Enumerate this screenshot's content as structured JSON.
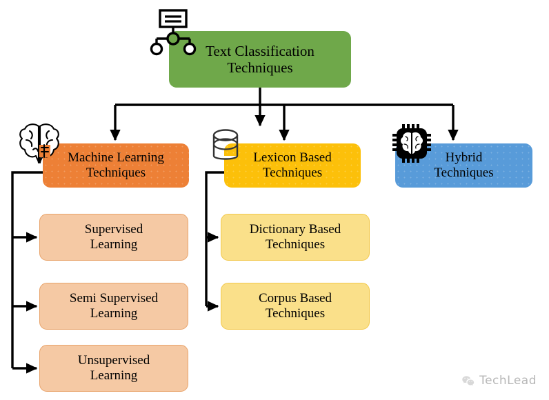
{
  "diagram": {
    "title": "Text Classification Techniques",
    "root": {
      "label": "Text Classification\nTechniques",
      "color": "#6FA84A",
      "icon": "hierarchy-icon"
    },
    "branches": [
      {
        "id": "machine-learning",
        "label": "Machine Learning\nTechniques",
        "color": "#ED8036",
        "icon": "brain-icon",
        "children": [
          {
            "id": "supervised-learning",
            "label": "Supervised\nLearning",
            "color": "#F5C9A4",
            "border": "#E8A36A"
          },
          {
            "id": "semi-supervised-learning",
            "label": "Semi Supervised\nLearning",
            "color": "#F5C9A4",
            "border": "#E8A36A"
          },
          {
            "id": "unsupervised-learning",
            "label": "Unsupervised\nLearning",
            "color": "#F5C9A4",
            "border": "#E8A36A"
          }
        ]
      },
      {
        "id": "lexicon-based",
        "label": "Lexicon Based\nTechniques",
        "color": "#FCC00A",
        "icon": "database-icon",
        "children": [
          {
            "id": "dictionary-based",
            "label": "Dictionary Based\nTechniques",
            "color": "#FAE08A",
            "border": "#F2C84B"
          },
          {
            "id": "corpus-based",
            "label": "Corpus Based\nTechniques",
            "color": "#FAE08A",
            "border": "#F2C84B"
          }
        ]
      },
      {
        "id": "hybrid",
        "label": "Hybrid\nTechniques",
        "color": "#589BD9",
        "icon": "chip-brain-icon",
        "children": []
      }
    ],
    "connector_color": "#000000"
  },
  "watermark": {
    "text": "TechLead",
    "icon": "wechat-icon",
    "color": "#8c8c8c"
  }
}
